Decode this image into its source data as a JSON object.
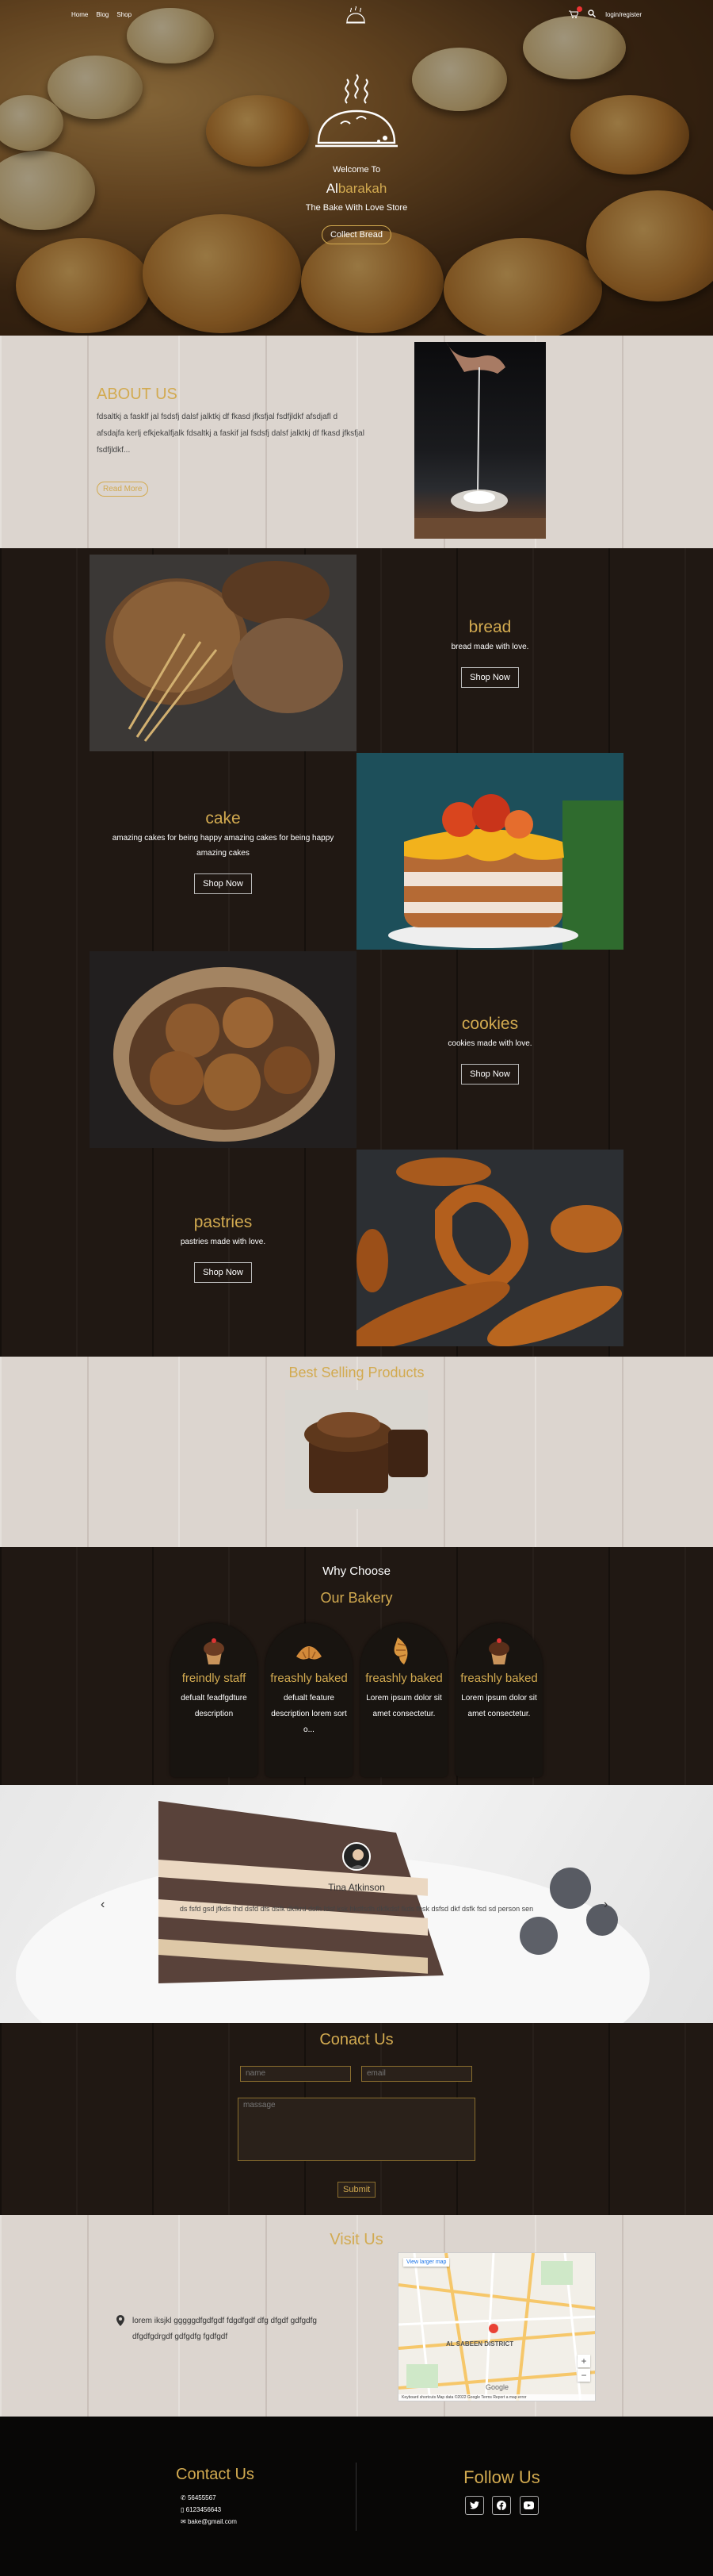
{
  "nav": {
    "links": [
      "Home",
      "Blog",
      "Shop"
    ],
    "login": "login/register"
  },
  "hero": {
    "welcome": "Welcome To",
    "brand_a": "Al",
    "brand_b": "barakah",
    "tagline": "The Bake With Love Store",
    "cta": "Collect Bread"
  },
  "about": {
    "title": "ABOUT US",
    "body": "fdsaltkj a fasklf jal fsdsfj dalsf jalktkj df fkasd jfksfjal fsdfjldkf afsdjafl d afsdajfa kerlj efkjekalfjalk fdsaltkj a faskif jal fsdsfj dalsf jalktkj df fkasd jfksfjal fsdfjldkf...",
    "button": "Read More"
  },
  "categories": [
    {
      "name": "bread",
      "desc": "bread made with love.",
      "button": "Shop Now"
    },
    {
      "name": "cake",
      "desc": "amazing cakes for being happy amazing cakes for being happy amazing cakes",
      "button": "Shop Now"
    },
    {
      "name": "cookies",
      "desc": "cookies made with love.",
      "button": "Shop Now"
    },
    {
      "name": "pastries",
      "desc": "pastries made with love.",
      "button": "Shop Now"
    }
  ],
  "best_selling": {
    "title": "Best Selling Products"
  },
  "why": {
    "title": "Why Choose",
    "subtitle": "Our Bakery",
    "features": [
      {
        "title": "freindly staff",
        "desc": "defualt feadfgdture description"
      },
      {
        "title": "freashly baked",
        "desc": "defualt feature description lorem sort o..."
      },
      {
        "title": "freashly baked",
        "desc": "Lorem ipsum dolor sit amet consectetur."
      },
      {
        "title": "freashly baked",
        "desc": "Lorem ipsum dolor sit amet consectetur."
      }
    ]
  },
  "testimonial": {
    "name": "Tina Atkinson",
    "quote": "ds fsfd gsd jfkds thd dsfd dfs dsfk dkfkrd dsfh fdsf ksk hkdfsdh dkfkdsf fkds fhsk dsfsd dkf dsfk fsd sd person sen"
  },
  "contact_form": {
    "title": "Conact Us",
    "name_placeholder": "name",
    "email_placeholder": "email",
    "message_placeholder": "massage",
    "submit": "Submit"
  },
  "visit": {
    "title": "Visit Us",
    "address": "lorem iksjkl gggggdfgdfgdf fdgdfgdf dfg dfgdf gdfgdfg dfgdfgdrgdf gdfgdfg fgdfgdf",
    "map_link": "View larger map",
    "map_district": "AL SABEEN DISTRICT",
    "map_footer": "Keyboard shortcuts   Map data ©2022 Google   Terms   Report a map error",
    "map_brand": "Google"
  },
  "footer": {
    "contact_title": "Contact Us",
    "phone1": "56455567",
    "phone2": "6123456643",
    "email": "bake@gmail.com",
    "follow_title": "Follow Us",
    "social": [
      "twitter-icon",
      "facebook-icon",
      "youtube-icon"
    ]
  },
  "colors": {
    "accent": "#d2aa50",
    "dark": "#201813",
    "light": "#dcd5cf"
  }
}
